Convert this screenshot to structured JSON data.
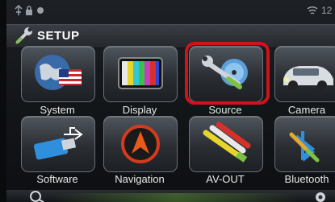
{
  "header": {
    "title": "SETUP"
  },
  "status": {
    "time": "12"
  },
  "tiles": [
    {
      "label": "System",
      "icon": "system-globe-flag-icon"
    },
    {
      "label": "Display",
      "icon": "display-tv-bars-icon"
    },
    {
      "label": "Source",
      "icon": "source-wrench-disc-icon",
      "selected": true
    },
    {
      "label": "Camera",
      "icon": "camera-car-icon"
    },
    {
      "label": "Software",
      "icon": "software-usb-icon"
    },
    {
      "label": "Navigation",
      "icon": "navigation-arrow-icon"
    },
    {
      "label": "AV-OUT",
      "icon": "av-out-rca-cable-icon"
    },
    {
      "label": "Bluetooth",
      "icon": "bluetooth-wrench-icon"
    }
  ],
  "colors": {
    "highlight": "#d0121a",
    "accent_green": "#8bd23c"
  }
}
